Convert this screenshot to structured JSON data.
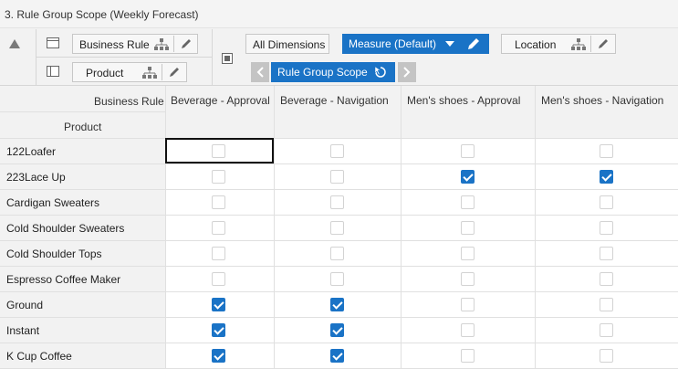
{
  "window": {
    "title": "3. Rule Group Scope (Weekly Forecast)"
  },
  "toolbar": {
    "column_dimension": "Business Rule",
    "row_dimension": "Product",
    "all_dimensions": "All Dimensions",
    "measure": "Measure (Default)",
    "location": "Location",
    "rule_group_scope": "Rule Group Scope"
  },
  "grid": {
    "column_header_title": "Business Rule",
    "row_header_title": "Product",
    "columns": [
      "Beverage - Approval",
      "Beverage - Navigation",
      "Men's shoes - Approval",
      "Men's shoes - Navigation"
    ],
    "rows": [
      {
        "label": "122Loafer",
        "checked": [
          false,
          false,
          false,
          false
        ],
        "disabled": [
          true,
          true,
          true,
          true
        ]
      },
      {
        "label": "223Lace Up",
        "checked": [
          false,
          false,
          true,
          true
        ],
        "disabled": [
          true,
          true,
          false,
          false
        ]
      },
      {
        "label": "Cardigan Sweaters",
        "checked": [
          false,
          false,
          false,
          false
        ],
        "disabled": [
          true,
          true,
          true,
          true
        ]
      },
      {
        "label": "Cold Shoulder Sweaters",
        "checked": [
          false,
          false,
          false,
          false
        ],
        "disabled": [
          true,
          true,
          true,
          true
        ]
      },
      {
        "label": "Cold Shoulder Tops",
        "checked": [
          false,
          false,
          false,
          false
        ],
        "disabled": [
          true,
          true,
          true,
          true
        ]
      },
      {
        "label": "Espresso Coffee Maker",
        "checked": [
          false,
          false,
          false,
          false
        ],
        "disabled": [
          true,
          true,
          true,
          true
        ]
      },
      {
        "label": "Ground",
        "checked": [
          true,
          true,
          false,
          false
        ],
        "disabled": [
          false,
          false,
          true,
          true
        ]
      },
      {
        "label": "Instant",
        "checked": [
          true,
          true,
          false,
          false
        ],
        "disabled": [
          false,
          false,
          true,
          true
        ]
      },
      {
        "label": "K Cup Coffee",
        "checked": [
          true,
          true,
          false,
          false
        ],
        "disabled": [
          false,
          false,
          true,
          true
        ]
      }
    ]
  },
  "colors": {
    "accent": "#1a73c6",
    "header_bg": "#f2f2f2"
  }
}
